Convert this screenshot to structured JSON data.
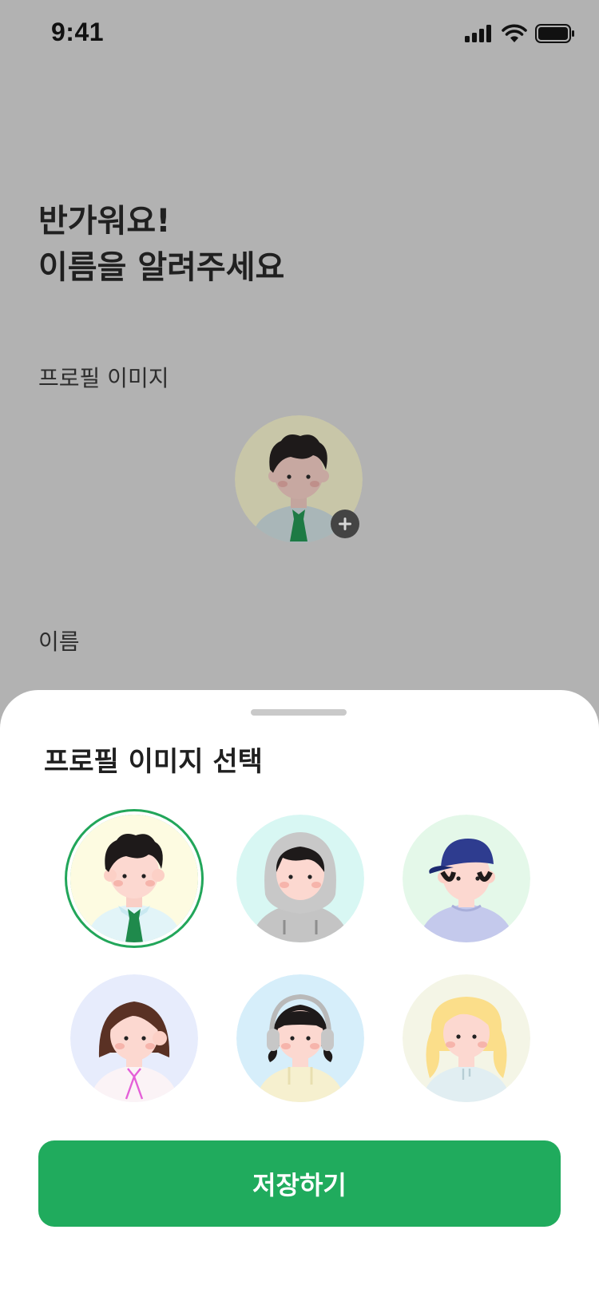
{
  "status_bar": {
    "time": "9:41"
  },
  "header": {
    "greeting_line1": "반가워요!",
    "greeting_line2": "이름을 알려주세요"
  },
  "form": {
    "profile_label": "프로필 이미지",
    "name_label": "이름"
  },
  "sheet": {
    "title": "프로필 이미지 선택",
    "save_label": "저장하기",
    "avatars": [
      {
        "id": "curly-hair-tie",
        "bg": "#fdfbe1",
        "selected": true
      },
      {
        "id": "gray-hoodie",
        "bg": "#d8f7f3",
        "selected": false
      },
      {
        "id": "blue-cap",
        "bg": "#e4f8e9",
        "selected": false
      },
      {
        "id": "brown-bob-ribbon",
        "bg": "#e7ecfc",
        "selected": false
      },
      {
        "id": "headphones",
        "bg": "#d6eefa",
        "selected": false
      },
      {
        "id": "blonde-wavy",
        "bg": "#f4f5e6",
        "selected": false
      }
    ]
  },
  "colors": {
    "accent": "#20ab5d",
    "overlay": "#b2b2b2"
  }
}
